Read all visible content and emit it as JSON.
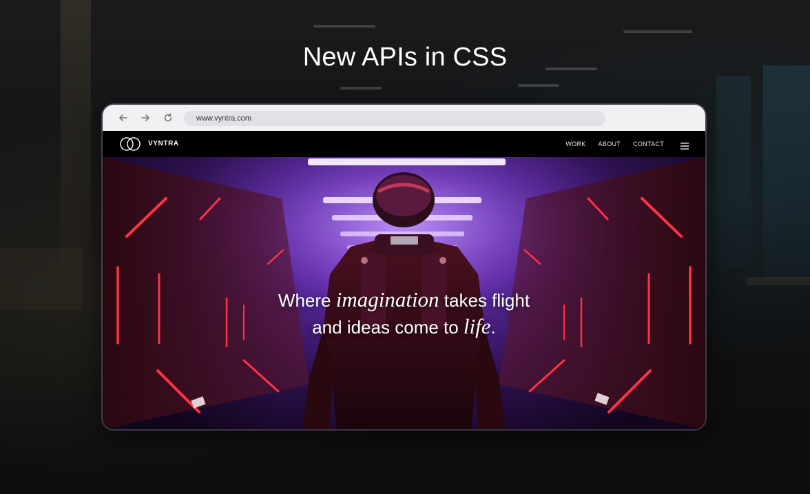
{
  "slide": {
    "title": "New APIs in CSS"
  },
  "browser": {
    "url": "www.vyntra.com",
    "icons": [
      "back-arrow-icon",
      "forward-arrow-icon",
      "reload-icon"
    ]
  },
  "site": {
    "brand": "VYNTRA",
    "nav": [
      "WORK",
      "ABOUT",
      "CONTACT"
    ],
    "menu_icon": "hamburger-menu-icon"
  },
  "hero": {
    "line1_pre": "Where ",
    "line1_em": "imagination",
    "line1_post": " takes flight",
    "line2_pre": "and ideas come to ",
    "line2_em": "life",
    "line2_post": "."
  },
  "colors": {
    "accent_neon_red": "#ff3344",
    "accent_purple": "#8a4fd6"
  }
}
